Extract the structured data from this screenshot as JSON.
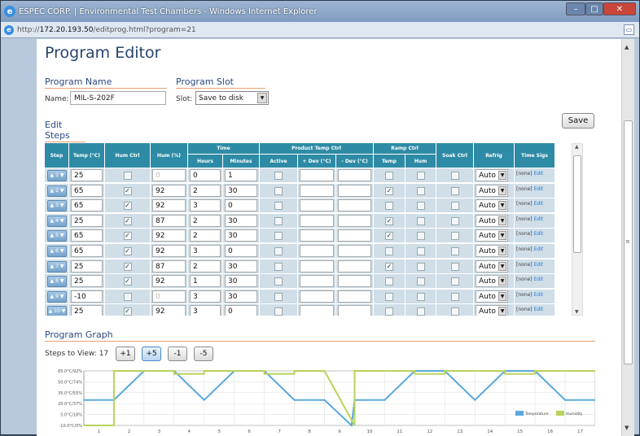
{
  "window": {
    "title": "ESPEC CORP. | Environmental Test Chambers - Windows Internet Explorer"
  },
  "address": {
    "prefix": "http://",
    "host": "172.20.193.50",
    "path": "/editprog.html?program=21"
  },
  "page": {
    "title": "Program Editor"
  },
  "program_name": {
    "section": "Program Name",
    "label": "Name:",
    "value": "MIL-S-202F"
  },
  "program_slot": {
    "section": "Program Slot",
    "label": "Slot:",
    "value": "Save to disk"
  },
  "edit_steps": {
    "section": "Edit Steps",
    "save_label": "Save"
  },
  "table": {
    "headers": {
      "step": "Step",
      "temp": "Temp (°C)",
      "hum_ctrl": "Hum Ctrl",
      "hum": "Hum (%)",
      "time": "Time",
      "hours": "Hours",
      "minutes": "Minutes",
      "product_temp_ctrl": "Product Temp Ctrl",
      "active": "Active",
      "pdev": "+ Dev (°C)",
      "mdev": "- Dev (°C)",
      "ramp_ctrl": "Ramp Ctrl",
      "ramp_temp": "Temp",
      "ramp_hum": "Hum",
      "soak_ctrl": "Soak Ctrl",
      "refrig": "Refrig",
      "time_sigs": "Time Sigs"
    },
    "rows": [
      {
        "step": "1",
        "temp": "25",
        "hum_ctrl": false,
        "hum": "0",
        "hours": "0",
        "minutes": "1",
        "ramp_temp": false,
        "refrig": "Auto",
        "sigs": "[none]",
        "edit": "Edit"
      },
      {
        "step": "2",
        "temp": "65",
        "hum_ctrl": true,
        "hum": "92",
        "hours": "2",
        "minutes": "30",
        "ramp_temp": true,
        "refrig": "Auto",
        "sigs": "[none]",
        "edit": "Edit"
      },
      {
        "step": "3",
        "temp": "65",
        "hum_ctrl": true,
        "hum": "92",
        "hours": "3",
        "minutes": "0",
        "ramp_temp": false,
        "refrig": "Auto",
        "sigs": "[none]",
        "edit": "Edit"
      },
      {
        "step": "4",
        "temp": "25",
        "hum_ctrl": true,
        "hum": "87",
        "hours": "2",
        "minutes": "30",
        "ramp_temp": true,
        "refrig": "Auto",
        "sigs": "[none]",
        "edit": "Edit"
      },
      {
        "step": "5",
        "temp": "65",
        "hum_ctrl": true,
        "hum": "92",
        "hours": "2",
        "minutes": "30",
        "ramp_temp": true,
        "refrig": "Auto",
        "sigs": "[none]",
        "edit": "Edit"
      },
      {
        "step": "6",
        "temp": "65",
        "hum_ctrl": true,
        "hum": "92",
        "hours": "3",
        "minutes": "0",
        "ramp_temp": false,
        "refrig": "Auto",
        "sigs": "[none]",
        "edit": "Edit"
      },
      {
        "step": "7",
        "temp": "25",
        "hum_ctrl": true,
        "hum": "87",
        "hours": "2",
        "minutes": "30",
        "ramp_temp": true,
        "refrig": "Auto",
        "sigs": "[none]",
        "edit": "Edit"
      },
      {
        "step": "8",
        "temp": "25",
        "hum_ctrl": true,
        "hum": "92",
        "hours": "1",
        "minutes": "30",
        "ramp_temp": false,
        "refrig": "Auto",
        "sigs": "[none]",
        "edit": "Edit"
      },
      {
        "step": "9",
        "temp": "-10",
        "hum_ctrl": false,
        "hum": "0",
        "hours": "3",
        "minutes": "30",
        "ramp_temp": false,
        "refrig": "Auto",
        "sigs": "[none]",
        "edit": "Edit"
      },
      {
        "step": "10",
        "temp": "25",
        "hum_ctrl": true,
        "hum": "92",
        "hours": "3",
        "minutes": "0",
        "ramp_temp": false,
        "refrig": "Auto",
        "sigs": "[none]",
        "edit": "Edit"
      }
    ]
  },
  "program_graph": {
    "section": "Program Graph",
    "steps_label": "Steps to View: 17",
    "buttons": [
      "+1",
      "+5",
      "-1",
      "-5"
    ]
  },
  "chart_data": {
    "type": "line",
    "x_ticks": [
      "1",
      "2",
      "3",
      "4",
      "5",
      "6",
      "7",
      "8",
      "9",
      "10",
      "11",
      "12",
      "13",
      "14",
      "15",
      "16",
      "17"
    ],
    "y_ticks": [
      "65.0°C/92%",
      "50.0°C/74%",
      "35.0°C/55%",
      "20.0°C/37%",
      "5.0°C/18%",
      "-10.0°C/0%"
    ],
    "ylim": [
      -10,
      65
    ],
    "series": [
      {
        "name": "Temperature",
        "color": "#5aa9de",
        "points": [
          [
            0,
            25
          ],
          [
            1,
            25
          ],
          [
            2,
            65
          ],
          [
            3,
            65
          ],
          [
            4,
            25
          ],
          [
            5,
            65
          ],
          [
            6,
            65
          ],
          [
            7,
            25
          ],
          [
            8,
            25
          ],
          [
            8.9,
            -10
          ],
          [
            9,
            25
          ],
          [
            10,
            25
          ],
          [
            11,
            65
          ],
          [
            12,
            65
          ],
          [
            13,
            25
          ],
          [
            14,
            65
          ],
          [
            15,
            65
          ],
          [
            16,
            25
          ],
          [
            17,
            25
          ]
        ]
      },
      {
        "name": "Humidity",
        "color": "#b8d35a",
        "points": [
          [
            0,
            -10
          ],
          [
            1,
            -10
          ],
          [
            1,
            65
          ],
          [
            3,
            65
          ],
          [
            3,
            61
          ],
          [
            4,
            61
          ],
          [
            4,
            65
          ],
          [
            6,
            65
          ],
          [
            6,
            61
          ],
          [
            7,
            61
          ],
          [
            7,
            65
          ],
          [
            8,
            65
          ],
          [
            9,
            -10
          ],
          [
            9,
            65
          ],
          [
            11,
            65
          ],
          [
            11,
            61
          ],
          [
            12,
            61
          ],
          [
            12,
            65
          ],
          [
            14,
            65
          ],
          [
            14,
            61
          ],
          [
            15,
            61
          ],
          [
            15,
            65
          ],
          [
            17,
            65
          ]
        ]
      }
    ],
    "grid": true,
    "legend": "bottom-right"
  }
}
